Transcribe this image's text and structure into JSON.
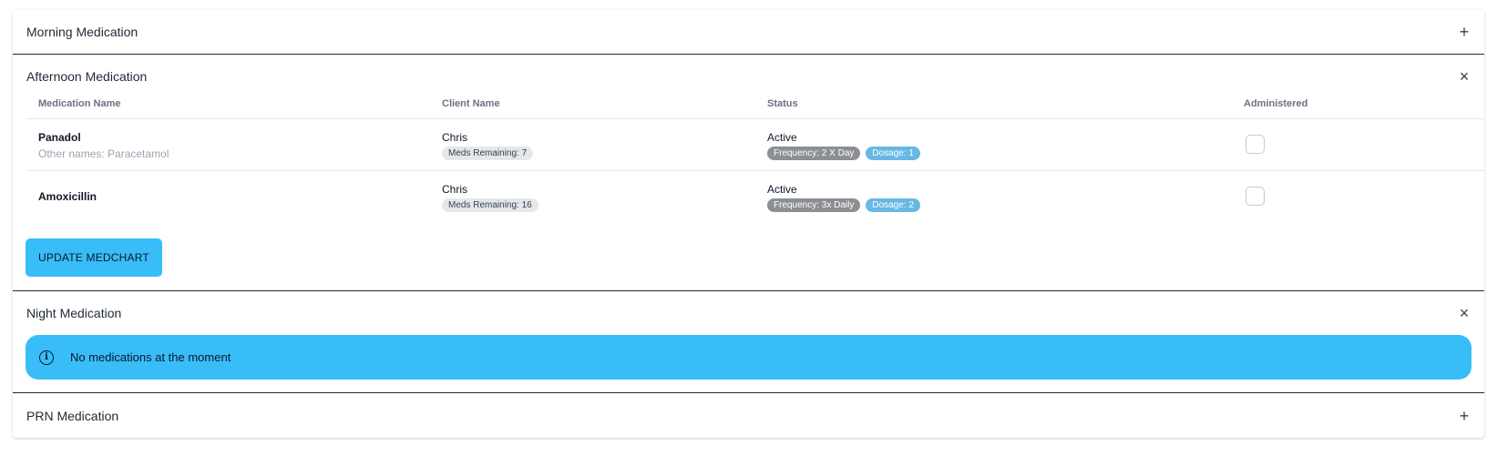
{
  "sections": [
    {
      "title": "Morning Medication",
      "toggle": "+"
    },
    {
      "title": "Afternoon Medication",
      "toggle": "×"
    },
    {
      "title": "Night Medication",
      "toggle": "×"
    },
    {
      "title": "PRN Medication",
      "toggle": "+"
    }
  ],
  "afternoon": {
    "columns": [
      "Medication Name",
      "Client Name",
      "Status",
      "Administered"
    ],
    "rows": [
      {
        "name": "Panadol",
        "other": "Other names: Paracetamol",
        "client": "Chris",
        "remaining": "Meds Remaining: 7",
        "status": "Active",
        "frequency": "Frequency: 2 X Day",
        "dosage": "Dosage: 1",
        "administered": false
      },
      {
        "name": "Amoxicillin",
        "client": "Chris",
        "remaining": "Meds Remaining: 16",
        "status": "Active",
        "frequency": "Frequency: 3x Daily",
        "dosage": "Dosage: 2",
        "administered": false
      }
    ],
    "update_button": "UPDATE MEDCHART"
  },
  "night": {
    "alert_icon": "info-icon",
    "alert_text": "No medications at the moment"
  }
}
